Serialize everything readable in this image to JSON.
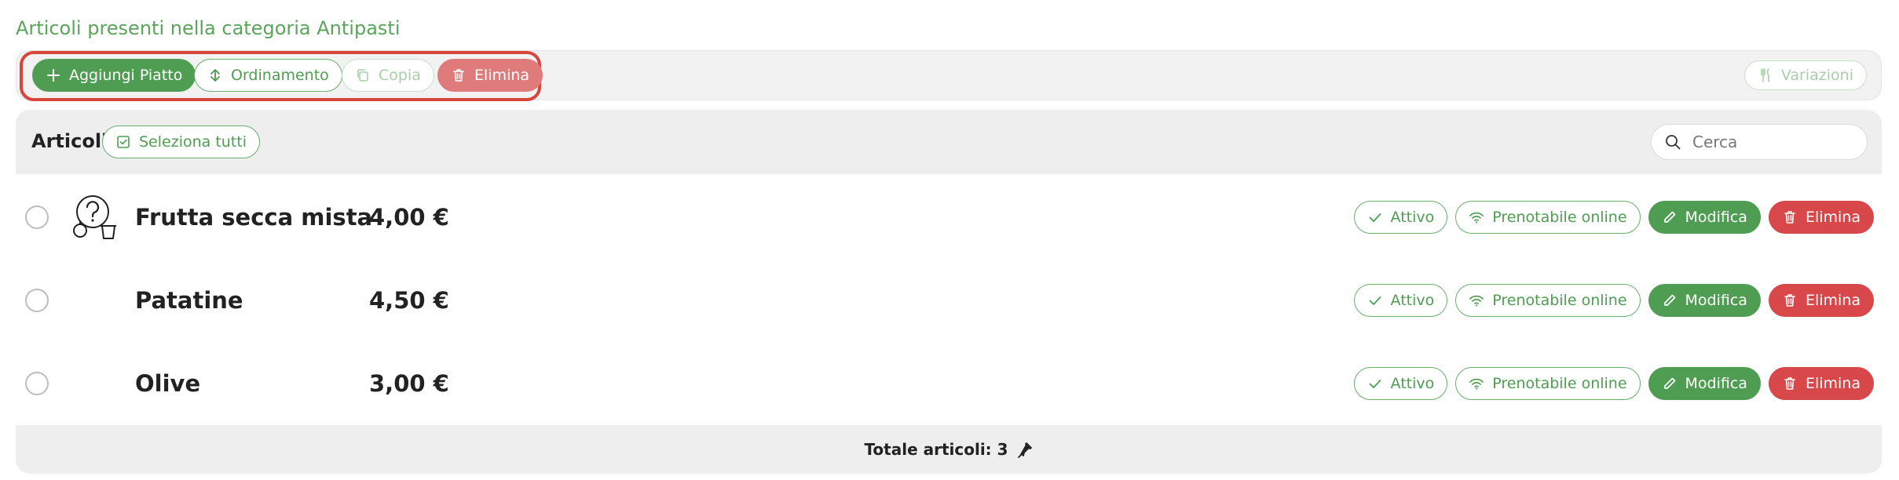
{
  "heading": "Articoli presenti nella categoria Antipasti",
  "toolbar": {
    "add_label": "Aggiungi Piatto",
    "sort_label": "Ordinamento",
    "copy_label": "Copia",
    "delete_label": "Elimina",
    "variations_label": "Variazioni"
  },
  "articles": {
    "title": "Articoli",
    "select_all_label": "Seleziona tutti",
    "search_placeholder": "Cerca"
  },
  "items": [
    {
      "name": "Frutta secca mista",
      "price": "4,00 €",
      "status": "Attivo",
      "online": "Prenotabile online",
      "edit": "Modifica",
      "delete": "Elimina",
      "has_image_placeholder": true
    },
    {
      "name": "Patatine",
      "price": "4,50 €",
      "status": "Attivo",
      "online": "Prenotabile online",
      "edit": "Modifica",
      "delete": "Elimina",
      "has_image_placeholder": false
    },
    {
      "name": "Olive",
      "price": "3,00 €",
      "status": "Attivo",
      "online": "Prenotabile online",
      "edit": "Modifica",
      "delete": "Elimina",
      "has_image_placeholder": false
    }
  ],
  "footer": {
    "total_label": "Totale articoli: 3"
  },
  "colors": {
    "green": "#4f9d52",
    "red": "#d8474a",
    "highlight": "#d7453b"
  },
  "icons": {
    "add": "plus-icon",
    "sort": "sort-icon",
    "copy": "copy-icon",
    "delete": "trash-icon",
    "variations": "fork-knife-icon",
    "select_all": "checkbox-icon",
    "search": "search-icon",
    "active": "check-icon",
    "online": "wifi-icon",
    "edit": "pencil-icon",
    "footer": "pin-icon"
  }
}
